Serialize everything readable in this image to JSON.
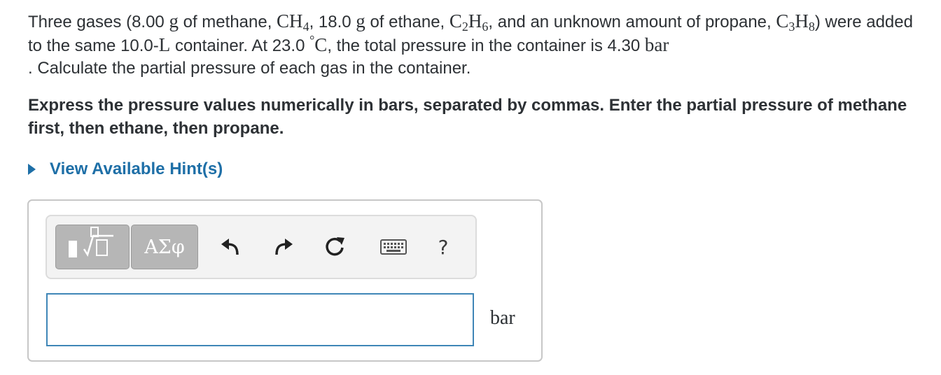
{
  "question": {
    "p1": "Three gases (8.00 ",
    "u_g1": "g",
    "p2": " of methane, ",
    "f_methane_a": "CH",
    "f_methane_b": "4",
    "p3": ", 18.0 ",
    "u_g2": "g",
    "p4": " of ethane, ",
    "f_ethane_a": "C",
    "f_ethane_b": "2",
    "f_ethane_c": "H",
    "f_ethane_d": "6",
    "p5": ", and an unknown amount of propane, ",
    "f_propane_a": "C",
    "f_propane_b": "3",
    "f_propane_c": "H",
    "f_propane_d": "8",
    "p6": ") were added to the same 10.0-",
    "u_L": "L",
    "p7": " container. At 23.0 ",
    "deg": "°",
    "u_C": "C",
    "p8": ", the total pressure in the container is 4.30 ",
    "u_bar": "bar",
    "p9": ". Calculate the partial pressure of each gas in the container."
  },
  "instruction": "Express the pressure values numerically in bars, separated by commas. Enter the partial pressure of methane first, then ethane, then propane.",
  "hint": {
    "label": "View Available Hint(s)"
  },
  "toolbar": {
    "greek_label": "ΑΣφ",
    "help_label": "?"
  },
  "answer": {
    "value": "",
    "unit": "bar"
  },
  "colors": {
    "link": "#1e6fa7",
    "input_border": "#3f86b7",
    "button_gray": "#b6b6b6"
  },
  "icons": [
    "template-icon",
    "undo-icon",
    "redo-icon",
    "reset-icon",
    "keyboard-icon",
    "help-icon"
  ]
}
